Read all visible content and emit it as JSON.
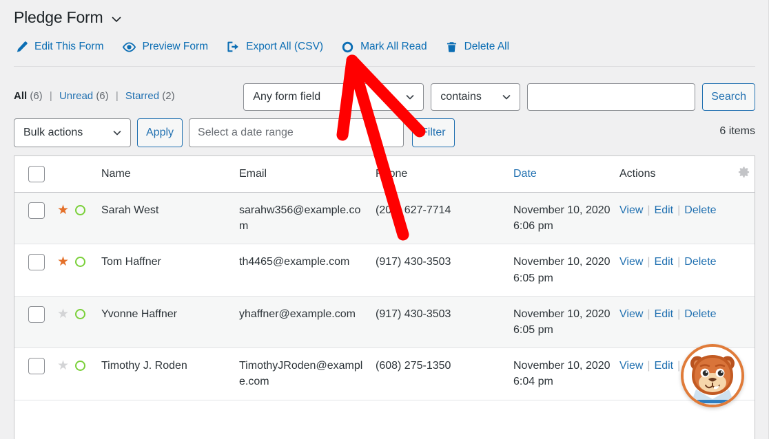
{
  "header": {
    "title": "Pledge Form",
    "caret_icon": "chevron-down-icon"
  },
  "toolbar": {
    "items": [
      {
        "label": "Edit This Form",
        "icon": "pencil-icon"
      },
      {
        "label": "Preview Form",
        "icon": "eye-icon"
      },
      {
        "label": "Export All (CSV)",
        "icon": "export-icon"
      },
      {
        "label": "Mark All Read",
        "icon": "circle-outline-icon"
      },
      {
        "label": "Delete All",
        "icon": "trash-icon"
      }
    ]
  },
  "filters": {
    "links": [
      {
        "label": "All",
        "count": "(6)",
        "current": true
      },
      {
        "label": "Unread",
        "count": "(6)",
        "current": false
      },
      {
        "label": "Starred",
        "count": "(2)",
        "current": false
      }
    ],
    "separator": "|"
  },
  "search": {
    "field_select": "Any form field",
    "compare_select": "contains",
    "input_value": "",
    "input_placeholder": "",
    "button_label": "Search"
  },
  "bulk": {
    "actions_select": "Bulk actions",
    "apply_label": "Apply",
    "daterange_value": "",
    "daterange_placeholder": "Select a date range",
    "filter_label": "Filter",
    "items_count": "6 items"
  },
  "table": {
    "columns": [
      {
        "key": "cb",
        "label": "",
        "sorted": false
      },
      {
        "key": "flag",
        "label": "",
        "sorted": false
      },
      {
        "key": "name",
        "label": "Name",
        "sorted": false
      },
      {
        "key": "email",
        "label": "Email",
        "sorted": false
      },
      {
        "key": "phone",
        "label": "Phone",
        "sorted": false
      },
      {
        "key": "date",
        "label": "Date",
        "sorted": true
      },
      {
        "key": "act",
        "label": "Actions",
        "sorted": false
      },
      {
        "key": "gear",
        "label": "",
        "sorted": false
      }
    ],
    "gear_icon": "gear-icon",
    "row_actions": {
      "view": "View",
      "edit": "Edit",
      "delete": "Delete",
      "separator": "|"
    },
    "rows": [
      {
        "starred": true,
        "unread": true,
        "name": "Sarah West",
        "email": "sarahw356@example.com",
        "phone": "(209) 627-7714",
        "date": "November 10, 2020 6:06 pm"
      },
      {
        "starred": true,
        "unread": true,
        "name": "Tom Haffner",
        "email": "th4465@example.com",
        "phone": "(917) 430-3503",
        "date": "November 10, 2020 6:05 pm"
      },
      {
        "starred": false,
        "unread": true,
        "name": "Yvonne Haffner",
        "email": "yhaffner@example.com",
        "phone": "(917) 430-3503",
        "date": "November 10, 2020 6:05 pm"
      },
      {
        "starred": false,
        "unread": true,
        "name": "Timothy J. Roden",
        "email": "TimothyJRoden@example.com",
        "phone": "(608) 275-1350",
        "date": "November 10, 2020 6:04 pm"
      }
    ]
  },
  "annotation": {
    "type": "arrow",
    "color": "#FF0000",
    "points_to": "Export All (CSV)"
  },
  "chat_widget": {
    "avatar_icon": "bear-mascot-avatar",
    "ring_color": "#e07b39"
  },
  "colors": {
    "link": "#2271b1",
    "toolbar_link": "#0c6eb4",
    "star_on": "#e4702a",
    "unread_ring": "#7ad03a",
    "page_bg": "#f0f0f1",
    "annotation_red": "#FF0000"
  }
}
